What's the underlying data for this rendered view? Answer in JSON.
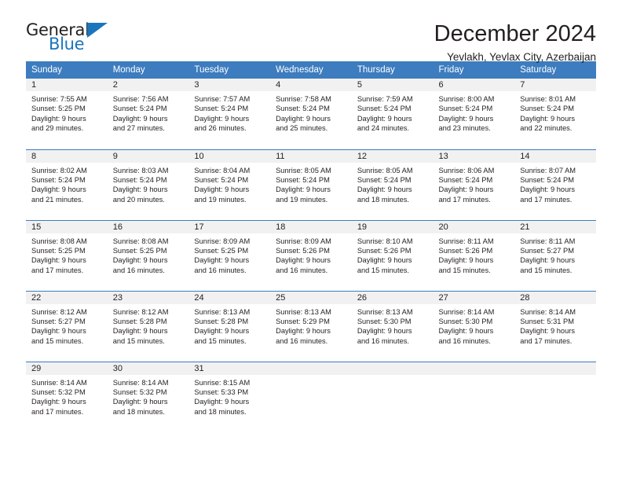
{
  "brand": {
    "name_part1": "General",
    "name_part2": "Blue",
    "accent_color": "#1b75bc"
  },
  "header": {
    "month_title": "December 2024",
    "location": "Yevlakh, Yevlax City, Azerbaijan"
  },
  "calendar": {
    "header_color": "#3c7cbf",
    "weekday_headers": [
      "Sunday",
      "Monday",
      "Tuesday",
      "Wednesday",
      "Thursday",
      "Friday",
      "Saturday"
    ],
    "weeks": [
      [
        {
          "day": "1",
          "sunrise": "Sunrise: 7:55 AM",
          "sunset": "Sunset: 5:25 PM",
          "daylight_line1": "Daylight: 9 hours",
          "daylight_line2": "and 29 minutes."
        },
        {
          "day": "2",
          "sunrise": "Sunrise: 7:56 AM",
          "sunset": "Sunset: 5:24 PM",
          "daylight_line1": "Daylight: 9 hours",
          "daylight_line2": "and 27 minutes."
        },
        {
          "day": "3",
          "sunrise": "Sunrise: 7:57 AM",
          "sunset": "Sunset: 5:24 PM",
          "daylight_line1": "Daylight: 9 hours",
          "daylight_line2": "and 26 minutes."
        },
        {
          "day": "4",
          "sunrise": "Sunrise: 7:58 AM",
          "sunset": "Sunset: 5:24 PM",
          "daylight_line1": "Daylight: 9 hours",
          "daylight_line2": "and 25 minutes."
        },
        {
          "day": "5",
          "sunrise": "Sunrise: 7:59 AM",
          "sunset": "Sunset: 5:24 PM",
          "daylight_line1": "Daylight: 9 hours",
          "daylight_line2": "and 24 minutes."
        },
        {
          "day": "6",
          "sunrise": "Sunrise: 8:00 AM",
          "sunset": "Sunset: 5:24 PM",
          "daylight_line1": "Daylight: 9 hours",
          "daylight_line2": "and 23 minutes."
        },
        {
          "day": "7",
          "sunrise": "Sunrise: 8:01 AM",
          "sunset": "Sunset: 5:24 PM",
          "daylight_line1": "Daylight: 9 hours",
          "daylight_line2": "and 22 minutes."
        }
      ],
      [
        {
          "day": "8",
          "sunrise": "Sunrise: 8:02 AM",
          "sunset": "Sunset: 5:24 PM",
          "daylight_line1": "Daylight: 9 hours",
          "daylight_line2": "and 21 minutes."
        },
        {
          "day": "9",
          "sunrise": "Sunrise: 8:03 AM",
          "sunset": "Sunset: 5:24 PM",
          "daylight_line1": "Daylight: 9 hours",
          "daylight_line2": "and 20 minutes."
        },
        {
          "day": "10",
          "sunrise": "Sunrise: 8:04 AM",
          "sunset": "Sunset: 5:24 PM",
          "daylight_line1": "Daylight: 9 hours",
          "daylight_line2": "and 19 minutes."
        },
        {
          "day": "11",
          "sunrise": "Sunrise: 8:05 AM",
          "sunset": "Sunset: 5:24 PM",
          "daylight_line1": "Daylight: 9 hours",
          "daylight_line2": "and 19 minutes."
        },
        {
          "day": "12",
          "sunrise": "Sunrise: 8:05 AM",
          "sunset": "Sunset: 5:24 PM",
          "daylight_line1": "Daylight: 9 hours",
          "daylight_line2": "and 18 minutes."
        },
        {
          "day": "13",
          "sunrise": "Sunrise: 8:06 AM",
          "sunset": "Sunset: 5:24 PM",
          "daylight_line1": "Daylight: 9 hours",
          "daylight_line2": "and 17 minutes."
        },
        {
          "day": "14",
          "sunrise": "Sunrise: 8:07 AM",
          "sunset": "Sunset: 5:24 PM",
          "daylight_line1": "Daylight: 9 hours",
          "daylight_line2": "and 17 minutes."
        }
      ],
      [
        {
          "day": "15",
          "sunrise": "Sunrise: 8:08 AM",
          "sunset": "Sunset: 5:25 PM",
          "daylight_line1": "Daylight: 9 hours",
          "daylight_line2": "and 17 minutes."
        },
        {
          "day": "16",
          "sunrise": "Sunrise: 8:08 AM",
          "sunset": "Sunset: 5:25 PM",
          "daylight_line1": "Daylight: 9 hours",
          "daylight_line2": "and 16 minutes."
        },
        {
          "day": "17",
          "sunrise": "Sunrise: 8:09 AM",
          "sunset": "Sunset: 5:25 PM",
          "daylight_line1": "Daylight: 9 hours",
          "daylight_line2": "and 16 minutes."
        },
        {
          "day": "18",
          "sunrise": "Sunrise: 8:09 AM",
          "sunset": "Sunset: 5:26 PM",
          "daylight_line1": "Daylight: 9 hours",
          "daylight_line2": "and 16 minutes."
        },
        {
          "day": "19",
          "sunrise": "Sunrise: 8:10 AM",
          "sunset": "Sunset: 5:26 PM",
          "daylight_line1": "Daylight: 9 hours",
          "daylight_line2": "and 15 minutes."
        },
        {
          "day": "20",
          "sunrise": "Sunrise: 8:11 AM",
          "sunset": "Sunset: 5:26 PM",
          "daylight_line1": "Daylight: 9 hours",
          "daylight_line2": "and 15 minutes."
        },
        {
          "day": "21",
          "sunrise": "Sunrise: 8:11 AM",
          "sunset": "Sunset: 5:27 PM",
          "daylight_line1": "Daylight: 9 hours",
          "daylight_line2": "and 15 minutes."
        }
      ],
      [
        {
          "day": "22",
          "sunrise": "Sunrise: 8:12 AM",
          "sunset": "Sunset: 5:27 PM",
          "daylight_line1": "Daylight: 9 hours",
          "daylight_line2": "and 15 minutes."
        },
        {
          "day": "23",
          "sunrise": "Sunrise: 8:12 AM",
          "sunset": "Sunset: 5:28 PM",
          "daylight_line1": "Daylight: 9 hours",
          "daylight_line2": "and 15 minutes."
        },
        {
          "day": "24",
          "sunrise": "Sunrise: 8:13 AM",
          "sunset": "Sunset: 5:28 PM",
          "daylight_line1": "Daylight: 9 hours",
          "daylight_line2": "and 15 minutes."
        },
        {
          "day": "25",
          "sunrise": "Sunrise: 8:13 AM",
          "sunset": "Sunset: 5:29 PM",
          "daylight_line1": "Daylight: 9 hours",
          "daylight_line2": "and 16 minutes."
        },
        {
          "day": "26",
          "sunrise": "Sunrise: 8:13 AM",
          "sunset": "Sunset: 5:30 PM",
          "daylight_line1": "Daylight: 9 hours",
          "daylight_line2": "and 16 minutes."
        },
        {
          "day": "27",
          "sunrise": "Sunrise: 8:14 AM",
          "sunset": "Sunset: 5:30 PM",
          "daylight_line1": "Daylight: 9 hours",
          "daylight_line2": "and 16 minutes."
        },
        {
          "day": "28",
          "sunrise": "Sunrise: 8:14 AM",
          "sunset": "Sunset: 5:31 PM",
          "daylight_line1": "Daylight: 9 hours",
          "daylight_line2": "and 17 minutes."
        }
      ],
      [
        {
          "day": "29",
          "sunrise": "Sunrise: 8:14 AM",
          "sunset": "Sunset: 5:32 PM",
          "daylight_line1": "Daylight: 9 hours",
          "daylight_line2": "and 17 minutes."
        },
        {
          "day": "30",
          "sunrise": "Sunrise: 8:14 AM",
          "sunset": "Sunset: 5:32 PM",
          "daylight_line1": "Daylight: 9 hours",
          "daylight_line2": "and 18 minutes."
        },
        {
          "day": "31",
          "sunrise": "Sunrise: 8:15 AM",
          "sunset": "Sunset: 5:33 PM",
          "daylight_line1": "Daylight: 9 hours",
          "daylight_line2": "and 18 minutes."
        },
        {
          "day": "",
          "sunrise": "",
          "sunset": "",
          "daylight_line1": "",
          "daylight_line2": ""
        },
        {
          "day": "",
          "sunrise": "",
          "sunset": "",
          "daylight_line1": "",
          "daylight_line2": ""
        },
        {
          "day": "",
          "sunrise": "",
          "sunset": "",
          "daylight_line1": "",
          "daylight_line2": ""
        },
        {
          "day": "",
          "sunrise": "",
          "sunset": "",
          "daylight_line1": "",
          "daylight_line2": ""
        }
      ]
    ]
  }
}
